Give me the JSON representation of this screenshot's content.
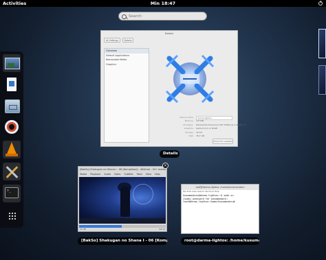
{
  "topbar": {
    "activities": "Activities",
    "clock": "Min 18:47"
  },
  "search": {
    "placeholder": "Search"
  },
  "dash": {
    "items": [
      {
        "name": "photos-icon"
      },
      {
        "name": "document-viewer-icon"
      },
      {
        "name": "files-icon"
      },
      {
        "name": "help-icon"
      },
      {
        "name": "vlc-icon"
      },
      {
        "name": "system-settings-icon"
      },
      {
        "name": "terminal-icon"
      },
      {
        "name": "show-applications-icon"
      }
    ]
  },
  "details_window": {
    "title": "Details",
    "buttons": [
      "All Settings",
      "Details"
    ],
    "list": [
      "Overview",
      "Default Applications",
      "Removable Media",
      "Graphics"
    ],
    "info": [
      {
        "k": "Device name",
        "v": "darma-lightos"
      },
      {
        "k": "Memory",
        "v": "3,8 GiB"
      },
      {
        "k": "Processor",
        "v": "Pentium(R) Dual-Core CPU T4400 @ 2.20GHz x 2"
      },
      {
        "k": "Graphics",
        "v": "Gallium 0.4 on NVA8"
      },
      {
        "k": "OS type",
        "v": "32-bit"
      },
      {
        "k": "Disk",
        "v": "78,7 GB"
      }
    ],
    "update_button": "Check for updates",
    "caption": "Details"
  },
  "vlc_window": {
    "title": "[BakSo] Shakugan no Shana I - 06 [Komplikasi] - AKUmai - VLC media player",
    "menu": [
      "Media",
      "Playback",
      "Audio",
      "Video",
      "Subtitle",
      "Tools",
      "View",
      "Help"
    ],
    "time_elapsed": "11:48",
    "time_total": "24:12",
    "progress": 0.49,
    "caption": "[BakSo] Shakugan no Shana I - 06 [Komplika..."
  },
  "terminal_window": {
    "title": "root@darma-lightos: /home/kusumandaru",
    "menu": [
      "File",
      "Edit",
      "View",
      "Search",
      "Terminal",
      "Help"
    ],
    "lines": [
      "kusumandaru@darma-lightos:~$ sudo su",
      "[sudo] password for kusumandaru:",
      "root@darma-lightos:/home/kusumandaru# "
    ],
    "caption": "root@darma-lightos: /home/kusumand..."
  },
  "colors": {
    "accent": "#3a79d6",
    "topbar": "#000000"
  }
}
